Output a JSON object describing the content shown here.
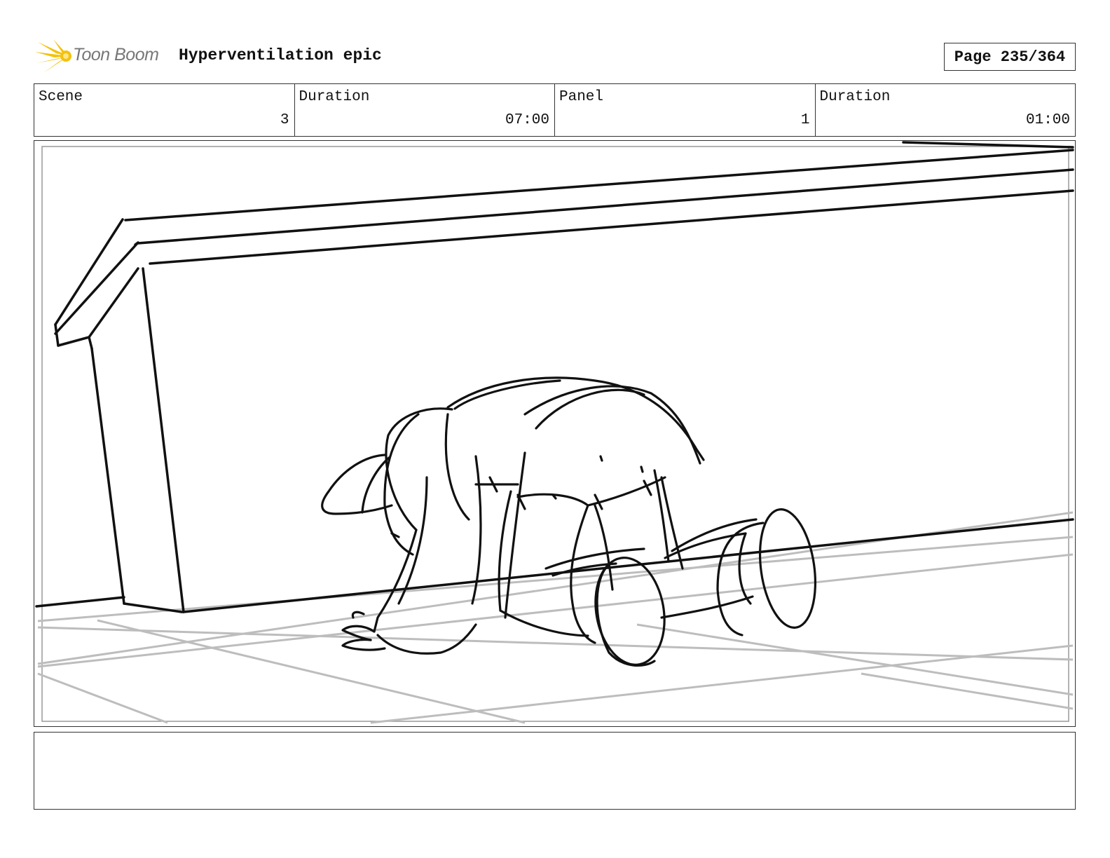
{
  "header": {
    "brand": "Toon Boom",
    "title": "Hyperventilation epic",
    "page": "Page 235/364"
  },
  "info": {
    "scene_label": "Scene",
    "scene_value": "3",
    "scene_duration_label": "Duration",
    "scene_duration_value": "07:00",
    "panel_label": "Panel",
    "panel_value": "1",
    "panel_duration_label": "Duration",
    "panel_duration_value": "01:00"
  },
  "notes": {
    "text": ""
  }
}
